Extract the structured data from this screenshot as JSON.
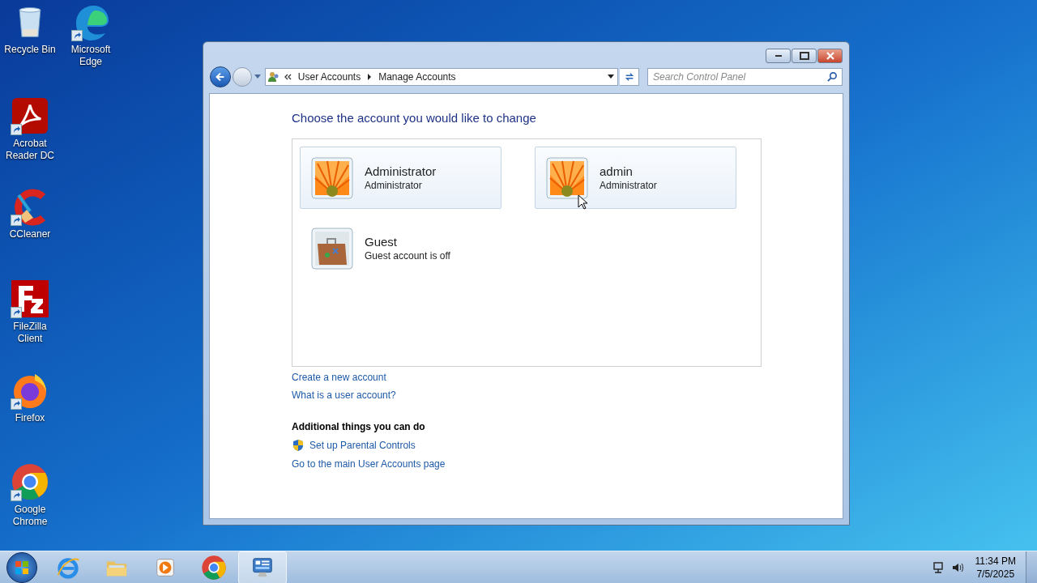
{
  "desktop_icons": [
    {
      "label": "Recycle Bin",
      "kind": "recycle",
      "shortcut": false
    },
    {
      "label": "Microsoft Edge",
      "kind": "edge",
      "shortcut": true
    },
    {
      "label": "Acrobat Reader DC",
      "kind": "acrobat",
      "shortcut": true
    },
    {
      "label": "CCleaner",
      "kind": "ccleaner",
      "shortcut": true
    },
    {
      "label": "FileZilla Client",
      "kind": "filezilla",
      "shortcut": true
    },
    {
      "label": "Firefox",
      "kind": "firefox",
      "shortcut": true
    },
    {
      "label": "Google Chrome",
      "kind": "chrome",
      "shortcut": true
    }
  ],
  "window": {
    "breadcrumb": [
      "User Accounts",
      "Manage Accounts"
    ],
    "search": {
      "placeholder": "Search Control Panel"
    },
    "heading": "Choose the account you would like to change",
    "accounts": [
      {
        "name": "Administrator",
        "type": "Administrator",
        "kind": "flower",
        "enabled": true
      },
      {
        "name": "admin",
        "type": "Administrator",
        "kind": "flower",
        "enabled": true
      },
      {
        "name": "Guest",
        "type": "Guest account is off",
        "kind": "briefcase",
        "enabled": false
      }
    ],
    "links": [
      "Create a new account",
      "What is a user account?"
    ],
    "additional": {
      "title": "Additional things you can do",
      "tasks": [
        {
          "label": "Set up Parental Controls",
          "kind": "shield"
        },
        {
          "label": "Go to the main User Accounts page",
          "kind": "plain"
        }
      ]
    }
  },
  "taskbar": {
    "items": [
      {
        "kind": "ie",
        "active": false
      },
      {
        "kind": "explorer",
        "active": false
      },
      {
        "kind": "media",
        "active": false
      },
      {
        "kind": "chrome",
        "active": false
      },
      {
        "kind": "control-panel",
        "active": true
      }
    ],
    "time": "11:34 PM",
    "date": "7/5/2025"
  }
}
